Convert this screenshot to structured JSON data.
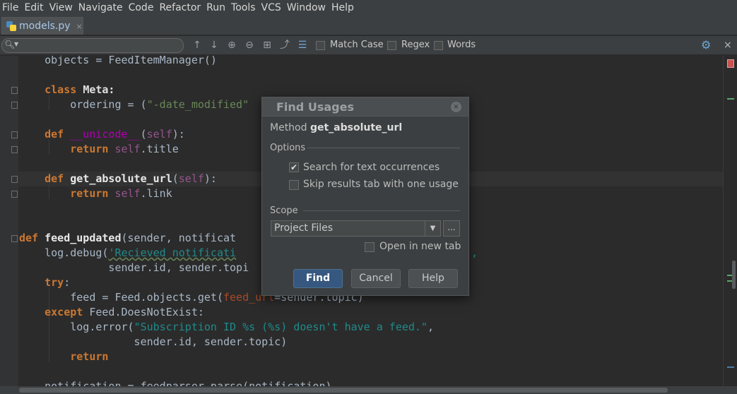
{
  "menu": [
    "File",
    "Edit",
    "View",
    "Navigate",
    "Code",
    "Refactor",
    "Run",
    "Tools",
    "VCS",
    "Window",
    "Help"
  ],
  "tab": {
    "filename": "models.py",
    "close": "×"
  },
  "search_bar": {
    "query": "",
    "options": [
      {
        "label": "Match Case",
        "checked": false
      },
      {
        "label": "Regex",
        "checked": false
      },
      {
        "label": "Words",
        "checked": false
      }
    ],
    "close": "×"
  },
  "editor": {
    "line_top": "    objects = FeedItemManager()",
    "line_class": "class",
    "line_meta": "Meta:",
    "line_ordering": "        ordering = (",
    "line_ordering_str": "\"-date_modified\"",
    "line_def": "def",
    "line_unicode_fn": "__unicode__",
    "line_self": "self",
    "line_return": "return",
    "line_self_title": ".title",
    "line_get_abs": "get_absolute_url",
    "line_self_link": ".link",
    "line_feed_updated": "feed_updated",
    "line_feed_updated_args": "(sender, notificat",
    "line_logdebug": "    log.debug(",
    "line_logdebug_str": "'Recieved notificati",
    "line_sender": "              sender.id, sender.topi",
    "line_try": "try",
    "line_feed_get": "        feed = Feed.objects.get(",
    "line_feed_url": "feed_url",
    "line_feed_get_rest": "=sender.topic)",
    "line_except": "except",
    "line_except_rest": " Feed.DoesNotExist:",
    "line_logerror": "        log.error(",
    "line_logerror_str": "\"Subscription ID %s (%s) doesn't have a feed.\"",
    "line_sender2": "                  sender.id, sender.topic)",
    "line_notification": "    notification = feedparser.parse(notification)"
  },
  "dialog": {
    "title": "Find Usages",
    "close": "×",
    "method_prefix": "Method",
    "method_name": "get_absolute_url",
    "options_label": "Options",
    "opt_text": "Search for text occurrences",
    "opt_text_checked": true,
    "opt_skip": "Skip results tab with one usage",
    "opt_skip_checked": false,
    "scope_label": "Scope",
    "scope_value": "Project Files",
    "more": "...",
    "open_new_tab": "Open in new tab",
    "open_new_tab_checked": false,
    "find_label": "Find",
    "cancel_label": "Cancel",
    "help_label": "Help"
  },
  "colors": {
    "keyword": "#cc7832",
    "function": "#ffc66d",
    "string": "#6a8759",
    "primary_button": "#365880"
  }
}
